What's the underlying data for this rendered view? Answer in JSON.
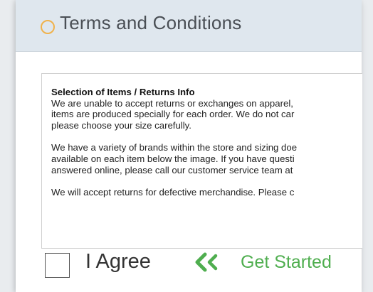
{
  "dialog": {
    "title": "Terms and Conditions"
  },
  "terms": {
    "heading": "Selection of Items / Returns Info",
    "paragraph1": [
      "We are unable to accept returns or exchanges on apparel,",
      "items are produced specially for each order. We do not car",
      "please choose your size carefully."
    ],
    "paragraph2": [
      "We have a variety of brands within the store and sizing doe",
      "available on each item below the image. If you have questi",
      "answered online, please call our customer service team at"
    ],
    "paragraph3": [
      "We will accept returns for defective merchandise. Please c"
    ]
  },
  "footer": {
    "agree_label": "I Agree",
    "get_started_label": "Get Started"
  },
  "colors": {
    "header_bg": "#dfe7ee",
    "header_icon": "#f0b24b",
    "accent_green": "#4fae4f"
  },
  "icons": {
    "header": "circle-icon",
    "get_started": "double-chevron-left-icon"
  }
}
